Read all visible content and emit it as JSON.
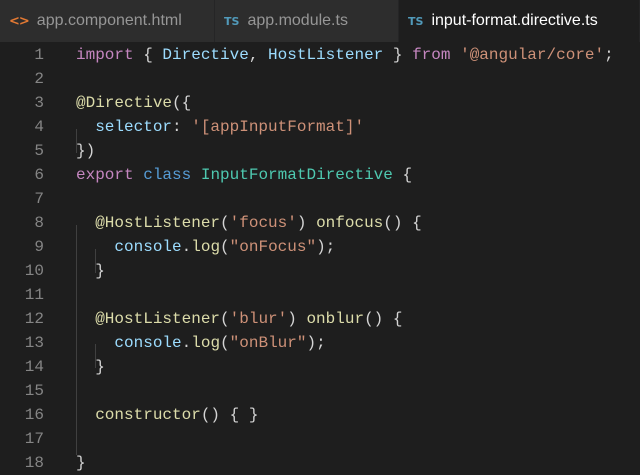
{
  "tabs": [
    {
      "icon": "<>",
      "icon_name": "html-file-icon",
      "label": "app.component.html",
      "active": false
    },
    {
      "icon": "TS",
      "icon_name": "typescript-file-icon",
      "label": "app.module.ts",
      "active": false
    },
    {
      "icon": "TS",
      "icon_name": "typescript-file-icon",
      "label": "input-format.directive.ts",
      "active": true
    }
  ],
  "editor": {
    "line_numbers": [
      "1",
      "2",
      "3",
      "4",
      "5",
      "6",
      "7",
      "8",
      "9",
      "10",
      "11",
      "12",
      "13",
      "14",
      "15",
      "16",
      "17",
      "18"
    ],
    "lines": [
      [
        [
          "kw",
          "import"
        ],
        [
          "punc",
          " { "
        ],
        [
          "prop",
          "Directive"
        ],
        [
          "punc",
          ", "
        ],
        [
          "prop",
          "HostListener"
        ],
        [
          "punc",
          " } "
        ],
        [
          "kw",
          "from"
        ],
        [
          "punc",
          " "
        ],
        [
          "str",
          "'@angular/core'"
        ],
        [
          "punc",
          ";"
        ]
      ],
      [],
      [
        [
          "fn",
          "@Directive"
        ],
        [
          "punc",
          "({"
        ]
      ],
      [
        [
          "punc",
          "  "
        ],
        [
          "prop",
          "selector"
        ],
        [
          "punc",
          ": "
        ],
        [
          "str",
          "'[appInputFormat]'"
        ]
      ],
      [
        [
          "punc",
          "})"
        ]
      ],
      [
        [
          "kw",
          "export"
        ],
        [
          "punc",
          " "
        ],
        [
          "kwb",
          "class"
        ],
        [
          "punc",
          " "
        ],
        [
          "cls",
          "InputFormatDirective"
        ],
        [
          "punc",
          " {"
        ]
      ],
      [],
      [
        [
          "punc",
          "  "
        ],
        [
          "fn",
          "@HostListener"
        ],
        [
          "punc",
          "("
        ],
        [
          "str",
          "'focus'"
        ],
        [
          "punc",
          ") "
        ],
        [
          "fn",
          "onfocus"
        ],
        [
          "punc",
          "() {"
        ]
      ],
      [
        [
          "punc",
          "    "
        ],
        [
          "prop",
          "console"
        ],
        [
          "punc",
          "."
        ],
        [
          "fn",
          "log"
        ],
        [
          "punc",
          "("
        ],
        [
          "str",
          "\"onFocus\""
        ],
        [
          "punc",
          ");"
        ]
      ],
      [
        [
          "punc",
          "  }"
        ]
      ],
      [],
      [
        [
          "punc",
          "  "
        ],
        [
          "fn",
          "@HostListener"
        ],
        [
          "punc",
          "("
        ],
        [
          "str",
          "'blur'"
        ],
        [
          "punc",
          ") "
        ],
        [
          "fn",
          "onblur"
        ],
        [
          "punc",
          "() {"
        ]
      ],
      [
        [
          "punc",
          "    "
        ],
        [
          "prop",
          "console"
        ],
        [
          "punc",
          "."
        ],
        [
          "fn",
          "log"
        ],
        [
          "punc",
          "("
        ],
        [
          "str",
          "\"onBlur\""
        ],
        [
          "punc",
          ");"
        ]
      ],
      [
        [
          "punc",
          "  }"
        ]
      ],
      [],
      [
        [
          "punc",
          "  "
        ],
        [
          "fn",
          "constructor"
        ],
        [
          "punc",
          "() { }"
        ]
      ],
      [],
      [
        [
          "punc",
          "}"
        ]
      ]
    ]
  }
}
